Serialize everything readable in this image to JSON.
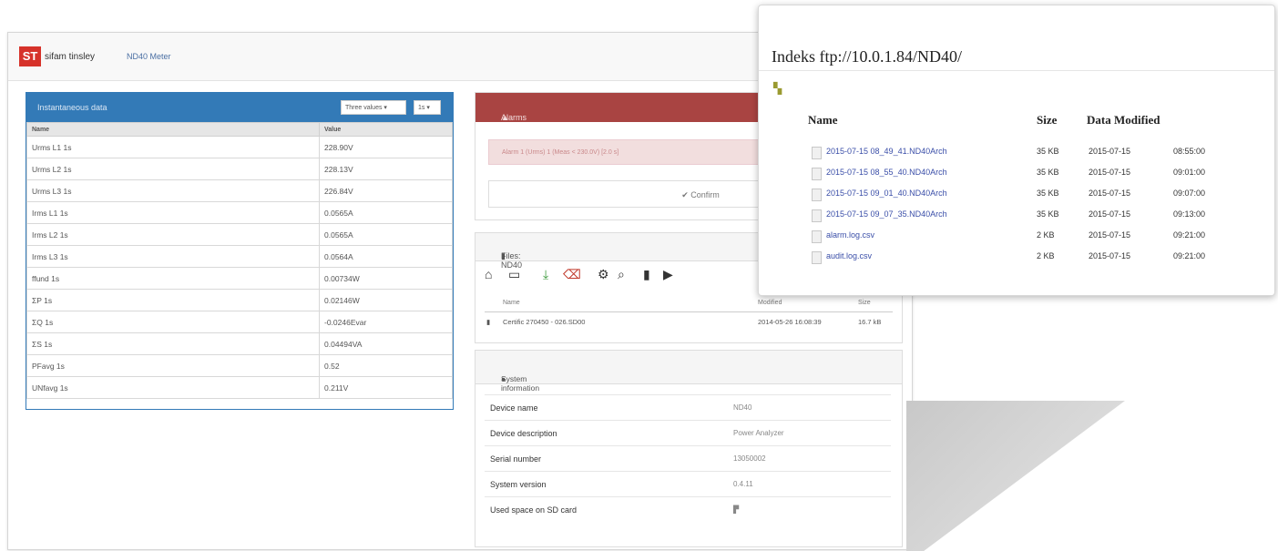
{
  "app": {
    "logo": "ST",
    "company": "sifam tinsley",
    "product": "ND40 Meter"
  },
  "measurement": {
    "title": "Instantaneous data",
    "select1": "Three values ▾",
    "select2": "1s ▾",
    "col_name": "Name",
    "col_value": "Value",
    "rows": [
      {
        "name": "Urms L1 1s",
        "value": "228.90V"
      },
      {
        "name": "Urms L2 1s",
        "value": "228.13V"
      },
      {
        "name": "Urms L3 1s",
        "value": "226.84V"
      },
      {
        "name": "Irms L1 1s",
        "value": "0.0565A"
      },
      {
        "name": "Irms L2 1s",
        "value": "0.0565A"
      },
      {
        "name": "Irms L3 1s",
        "value": "0.0564A"
      },
      {
        "name": "ffund 1s",
        "value": "0.00734W"
      },
      {
        "name": "ΣP 1s",
        "value": "0.02146W"
      },
      {
        "name": "ΣQ 1s",
        "value": "-0.0246Evar"
      },
      {
        "name": "ΣS 1s",
        "value": "0.04494VA"
      },
      {
        "name": "PFavg 1s",
        "value": "0.52"
      },
      {
        "name": "UNfavg 1s",
        "value": "0.211V"
      }
    ]
  },
  "alarms": {
    "title": "Alarms",
    "message": "Alarm 1 (Urms) 1 (Meas < 230.0V) [2.0 s]",
    "confirm": "✔ Confirm"
  },
  "files": {
    "title": "Files: ND40",
    "col_name": "Name",
    "col_modified": "Modified",
    "col_size": "Size",
    "rows": [
      {
        "name": "Certific 270450 - 026.SD00",
        "modified": "2014-05-26 16:08:39",
        "size": "16.7 kB"
      }
    ]
  },
  "system": {
    "title": "System information",
    "rows": [
      {
        "key": "Device name",
        "value": "ND40"
      },
      {
        "key": "Device description",
        "value": "Power Analyzer"
      },
      {
        "key": "Serial number",
        "value": "13050002"
      },
      {
        "key": "System version",
        "value": "0.4.11"
      },
      {
        "key": "Used space on SD card",
        "value": "▛"
      }
    ]
  },
  "ftp": {
    "title": "Indeks ftp://10.0.1.84/ND40/",
    "up_icon": "folder-up-icon",
    "col_name": "Name",
    "col_size": "Size",
    "col_modified": "Data Modified",
    "rows": [
      {
        "name": "2015-07-15 08_49_41.ND40Arch",
        "size": "35 KB",
        "date": "2015-07-15",
        "time": "08:55:00"
      },
      {
        "name": "2015-07-15 08_55_40.ND40Arch",
        "size": "35 KB",
        "date": "2015-07-15",
        "time": "09:01:00"
      },
      {
        "name": "2015-07-15 09_01_40.ND40Arch",
        "size": "35 KB",
        "date": "2015-07-15",
        "time": "09:07:00"
      },
      {
        "name": "2015-07-15 09_07_35.ND40Arch",
        "size": "35 KB",
        "date": "2015-07-15",
        "time": "09:13:00"
      },
      {
        "name": "alarm.log.csv",
        "size": "2 KB",
        "date": "2015-07-15",
        "time": "09:21:00"
      },
      {
        "name": "audit.log.csv",
        "size": "2 KB",
        "date": "2015-07-15",
        "time": "09:21:00"
      }
    ]
  },
  "colors": {
    "primary": "#337ab7",
    "danger": "#a94442",
    "logo": "#d6322a"
  }
}
